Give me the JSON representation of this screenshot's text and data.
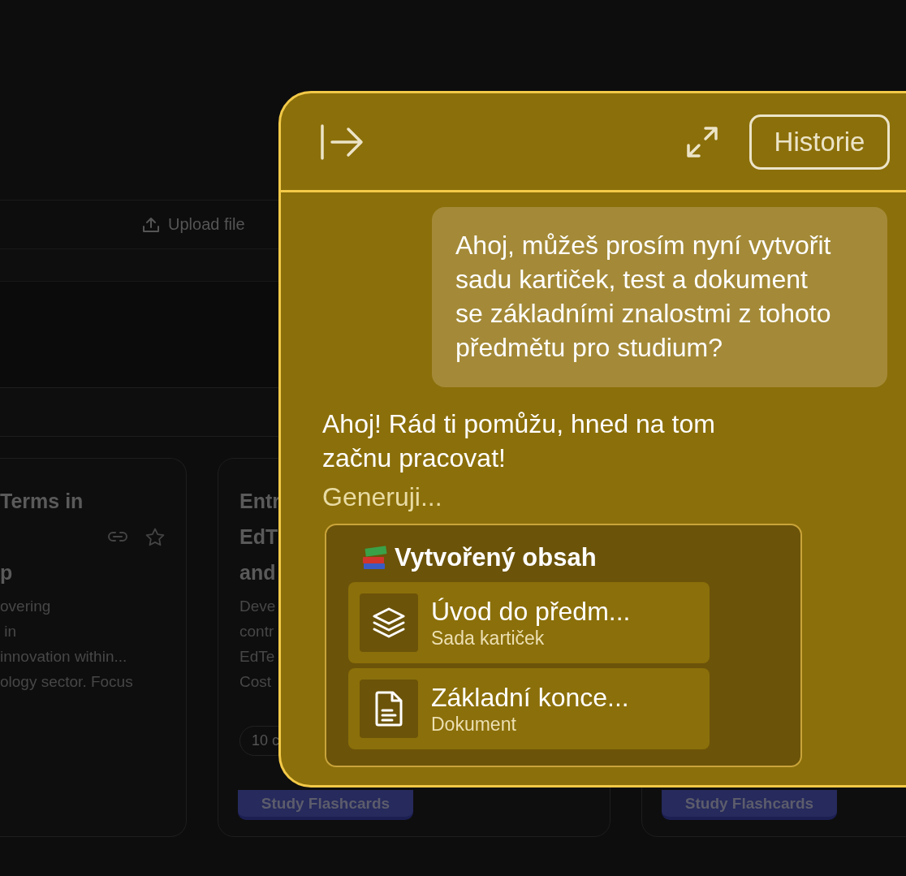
{
  "background": {
    "upload_button": "Upload file",
    "cards": [
      {
        "title_lines": [
          "Terms in",
          "p"
        ],
        "description_lines": [
          "overing",
          " in",
          "innovation within...",
          "ology sector. Focus"
        ]
      },
      {
        "title_lines": [
          "Entr",
          "EdT",
          "and"
        ],
        "description_lines": [
          "Deve",
          "contr",
          "EdTe",
          "Cost"
        ],
        "badge": "10 c",
        "button": "Study Flashcards"
      },
      {
        "button": "Study Flashcards"
      }
    ]
  },
  "chat_panel": {
    "history_button": "Historie",
    "user_message": "Ahoj, můžeš prosím nyní vytvořit sadu kartiček, test a dokument se základními znalostmi z tohoto předmětu pro studium?",
    "assistant_message": "Ahoj! Rád ti pomůžu, hned na tom začnu pracovat!",
    "status": "Generuji...",
    "content_card": {
      "title": "Vytvořený obsah",
      "items": [
        {
          "kind": "flashcards",
          "title": "Úvod do předm...",
          "subtitle": "Sada kartiček"
        },
        {
          "kind": "document",
          "title": "Základní konce...",
          "subtitle": "Dokument"
        }
      ]
    }
  }
}
